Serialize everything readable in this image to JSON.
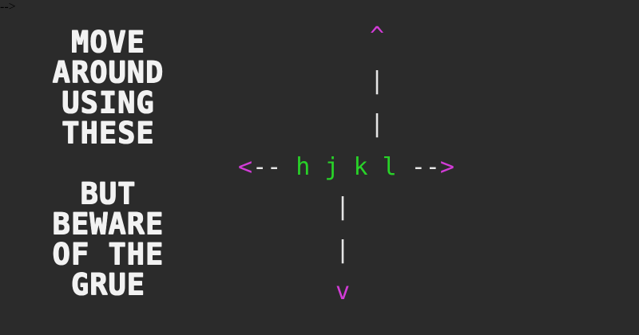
{
  "banner": {
    "lines_top": [
      "MOVE",
      "AROUND",
      "USING",
      "THESE"
    ],
    "lines_bottom": [
      "BUT",
      "BEWARE",
      "OF THE",
      "GRUE"
    ]
  },
  "keys": {
    "up_arrow": "^",
    "down_arrow": "v",
    "left_arrow": "<",
    "right_arrow": ">",
    "dashes_left": "--",
    "dashes_right": "--",
    "vertical_bar": "|",
    "h": "h",
    "j": "j",
    "k": "k",
    "l": "l"
  },
  "colors": {
    "background": "#2b2b2b",
    "banner_text": "#f2f2f2",
    "arrows": "#d23cd7",
    "keys": "#28d228",
    "lines": "#e6e6e6"
  }
}
